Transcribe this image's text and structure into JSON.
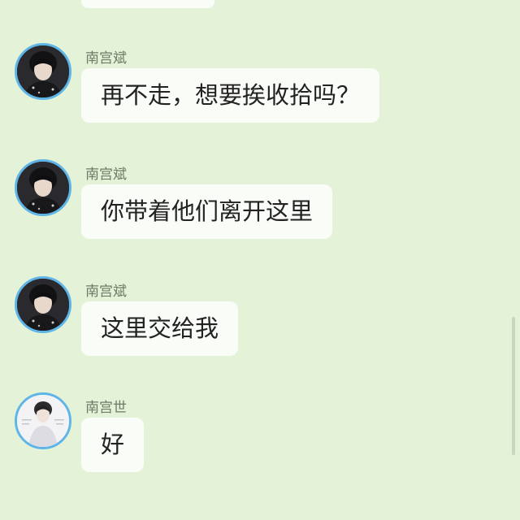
{
  "messages": [
    {
      "sender": "南宫斌",
      "text": "再不走，想要挨收拾吗？",
      "avatar": "dark-avatar"
    },
    {
      "sender": "南宫斌",
      "text": "你带着他们离开这里",
      "avatar": "dark-avatar"
    },
    {
      "sender": "南宫斌",
      "text": "这里交给我",
      "avatar": "dark-avatar"
    },
    {
      "sender": "南宫世",
      "text": "好",
      "avatar": "light-avatar"
    }
  ],
  "colors": {
    "background": "#e4f2d8",
    "bubble": "#fafdf7",
    "avatar_ring": "#5fb5e6",
    "name_text": "#6e7a68"
  }
}
